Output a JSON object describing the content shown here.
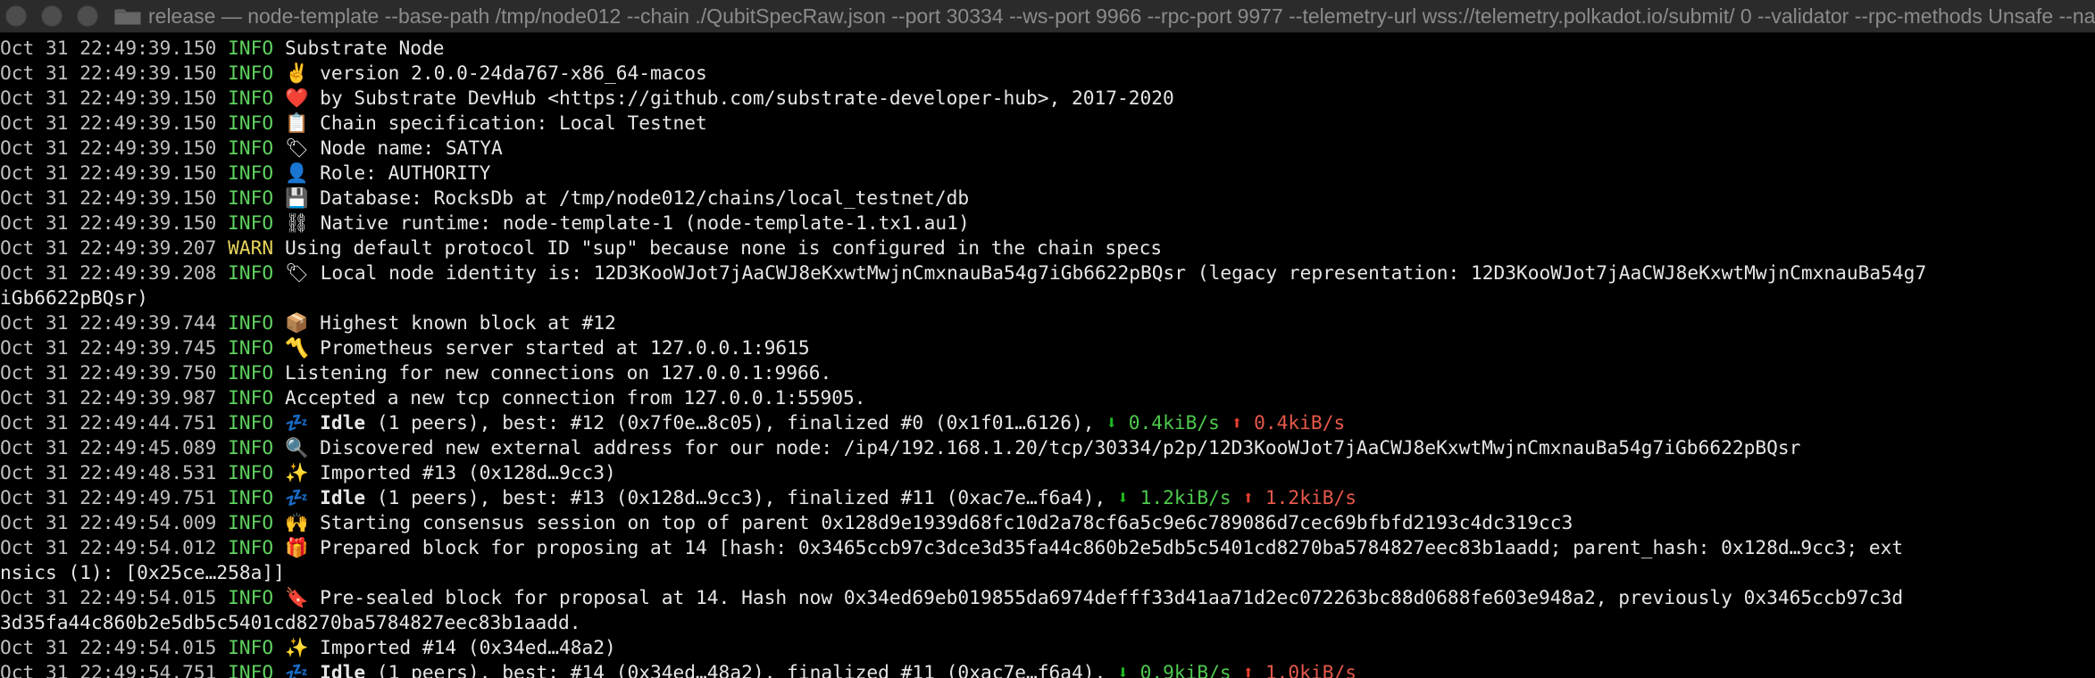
{
  "window": {
    "title": "release — node-template --base-path /tmp/node012 --chain ./QubitSpecRaw.json --port 30334 --ws-port 9966 --rpc-port 9977 --telemetry-url wss://telemetry.polkadot.io/submit/ 0 --validator --rpc-methods Unsafe --name SATYA",
    "folder_icon": "folder-icon"
  },
  "colors": {
    "background": "#000000",
    "info": "#5fd35f",
    "warn": "#e7d35a",
    "download": "#4ec94e",
    "upload": "#e7584b"
  },
  "log": [
    {
      "ts": "Oct 31 22:49:39.150",
      "level": "INFO",
      "icon": "",
      "text": "Substrate Node"
    },
    {
      "ts": "Oct 31 22:49:39.150",
      "level": "INFO",
      "icon": "✌️",
      "icon_name": "victory-hand-icon",
      "text": "version 2.0.0-24da767-x86_64-macos"
    },
    {
      "ts": "Oct 31 22:49:39.150",
      "level": "INFO",
      "icon": "❤️",
      "icon_name": "heart-icon",
      "text": "by Substrate DevHub <https://github.com/substrate-developer-hub>, 2017-2020"
    },
    {
      "ts": "Oct 31 22:49:39.150",
      "level": "INFO",
      "icon": "📋",
      "icon_name": "clipboard-icon",
      "text": "Chain specification: Local Testnet"
    },
    {
      "ts": "Oct 31 22:49:39.150",
      "level": "INFO",
      "icon": "🏷",
      "icon_name": "label-icon",
      "text": "Node name: SATYA"
    },
    {
      "ts": "Oct 31 22:49:39.150",
      "level": "INFO",
      "icon": "👤",
      "icon_name": "user-silhouette-icon",
      "text": "Role: AUTHORITY"
    },
    {
      "ts": "Oct 31 22:49:39.150",
      "level": "INFO",
      "icon": "💾",
      "icon_name": "floppy-disk-icon",
      "text": "Database: RocksDb at /tmp/node012/chains/local_testnet/db"
    },
    {
      "ts": "Oct 31 22:49:39.150",
      "level": "INFO",
      "icon": "⛓",
      "icon_name": "chains-icon",
      "text": "Native runtime: node-template-1 (node-template-1.tx1.au1)"
    },
    {
      "ts": "Oct 31 22:49:39.207",
      "level": "WARN",
      "icon": "",
      "text": "Using default protocol ID \"sup\" because none is configured in the chain specs"
    },
    {
      "ts": "Oct 31 22:49:39.208",
      "level": "INFO",
      "icon": "🏷",
      "icon_name": "label-icon",
      "text": "Local node identity is: 12D3KooWJot7jAaCWJ8eKxwtMwjnCmxnauBa54g7iGb6622pBQsr (legacy representation: 12D3KooWJot7jAaCWJ8eKxwtMwjnCmxnauBa54g7"
    },
    {
      "continuation": true,
      "text": "iGb6622pBQsr)"
    },
    {
      "ts": "Oct 31 22:49:39.744",
      "level": "INFO",
      "icon": "📦",
      "icon_name": "package-icon",
      "text": "Highest known block at #12"
    },
    {
      "ts": "Oct 31 22:49:39.745",
      "level": "INFO",
      "icon": "〽️",
      "icon_name": "part-alternation-mark-icon",
      "text": "Prometheus server started at 127.0.0.1:9615"
    },
    {
      "ts": "Oct 31 22:49:39.750",
      "level": "INFO",
      "icon": "",
      "text": "Listening for new connections on 127.0.0.1:9966."
    },
    {
      "ts": "Oct 31 22:49:39.987",
      "level": "INFO",
      "icon": "",
      "text": "Accepted a new tcp connection from 127.0.0.1:55905."
    },
    {
      "ts": "Oct 31 22:49:44.751",
      "level": "INFO",
      "icon": "💤",
      "icon_name": "sleep-icon",
      "bold": "Idle",
      "text": " (1 peers), best: #12 (0x7f0e…8c05), finalized #0 (0x1f01…6126), ",
      "down": "0.4kiB/s",
      "up": "0.4kiB/s"
    },
    {
      "ts": "Oct 31 22:49:45.089",
      "level": "INFO",
      "icon": "🔍",
      "icon_name": "magnifier-icon",
      "text": "Discovered new external address for our node: /ip4/192.168.1.20/tcp/30334/p2p/12D3KooWJot7jAaCWJ8eKxwtMwjnCmxnauBa54g7iGb6622pBQsr"
    },
    {
      "ts": "Oct 31 22:49:48.531",
      "level": "INFO",
      "icon": "✨",
      "icon_name": "sparkles-icon",
      "text": "Imported #13 (0x128d…9cc3)"
    },
    {
      "ts": "Oct 31 22:49:49.751",
      "level": "INFO",
      "icon": "💤",
      "icon_name": "sleep-icon",
      "bold": "Idle",
      "text": " (1 peers), best: #13 (0x128d…9cc3), finalized #11 (0xac7e…f6a4), ",
      "down": "1.2kiB/s",
      "up": "1.2kiB/s"
    },
    {
      "ts": "Oct 31 22:49:54.009",
      "level": "INFO",
      "icon": "🙌",
      "icon_name": "raised-hands-icon",
      "text": "Starting consensus session on top of parent 0x128d9e1939d68fc10d2a78cf6a5c9e6c789086d7cec69bfbfd2193c4dc319cc3"
    },
    {
      "ts": "Oct 31 22:49:54.012",
      "level": "INFO",
      "icon": "🎁",
      "icon_name": "gift-icon",
      "text": "Prepared block for proposing at 14 [hash: 0x3465ccb97c3dce3d35fa44c860b2e5db5c5401cd8270ba5784827eec83b1aadd; parent_hash: 0x128d…9cc3; ext"
    },
    {
      "continuation": true,
      "text": "nsics (1): [0x25ce…258a]]"
    },
    {
      "ts": "Oct 31 22:49:54.015",
      "level": "INFO",
      "icon": "🔖",
      "icon_name": "bookmark-icon",
      "text": "Pre-sealed block for proposal at 14. Hash now 0x34ed69eb019855da6974defff33d41aa71d2ec072263bc88d0688fe603e948a2, previously 0x3465ccb97c3d"
    },
    {
      "continuation": true,
      "text": "3d35fa44c860b2e5db5c5401cd8270ba5784827eec83b1aadd."
    },
    {
      "ts": "Oct 31 22:49:54.015",
      "level": "INFO",
      "icon": "✨",
      "icon_name": "sparkles-icon",
      "text": "Imported #14 (0x34ed…48a2)"
    },
    {
      "ts": "Oct 31 22:49:54.751",
      "level": "INFO",
      "icon": "💤",
      "icon_name": "sleep-icon",
      "bold": "Idle",
      "text": " (1 peers), best: #14 (0x34ed…48a2), finalized #11 (0xac7e…f6a4), ",
      "down": "0.9kiB/s",
      "up": "1.0kiB/s"
    }
  ]
}
